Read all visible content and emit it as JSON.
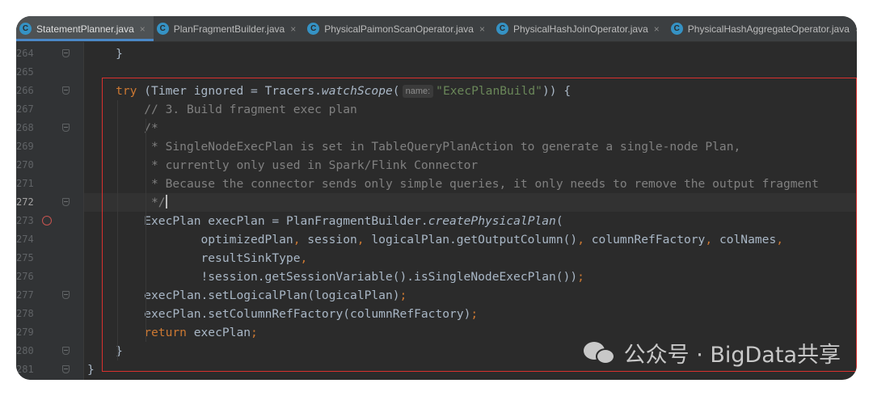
{
  "tabs": [
    {
      "label": "StatementPlanner.java",
      "active": true,
      "icon": "C"
    },
    {
      "label": "PlanFragmentBuilder.java",
      "active": false,
      "icon": "C"
    },
    {
      "label": "PhysicalPaimonScanOperator.java",
      "active": false,
      "icon": "C"
    },
    {
      "label": "PhysicalHashJoinOperator.java",
      "active": false,
      "icon": "C"
    },
    {
      "label": "PhysicalHashAggregateOperator.java",
      "active": false,
      "icon": "C"
    }
  ],
  "close_glyph": "×",
  "editor": {
    "current_line": "272",
    "breakpoint_line": "273",
    "lines": [
      {
        "n": "264",
        "indent": 4,
        "tokens": [
          {
            "t": "}",
            "c": ""
          }
        ]
      },
      {
        "n": "265",
        "indent": 0,
        "tokens": []
      },
      {
        "n": "266",
        "indent": 4,
        "tokens": [
          {
            "t": "try",
            "c": "kw"
          },
          {
            "t": " (Timer ignored = Tracers.",
            "c": ""
          },
          {
            "t": "watchScope",
            "c": "it"
          },
          {
            "t": "(",
            "c": ""
          },
          {
            "t": "name:",
            "c": "hint"
          },
          {
            "t": "\"ExecPlanBuild\"",
            "c": "str"
          },
          {
            "t": ")) {",
            "c": ""
          }
        ]
      },
      {
        "n": "267",
        "indent": 8,
        "tokens": [
          {
            "t": "// 3. Build fragment exec plan",
            "c": "cm"
          }
        ]
      },
      {
        "n": "268",
        "indent": 8,
        "tokens": [
          {
            "t": "/*",
            "c": "cm"
          }
        ]
      },
      {
        "n": "269",
        "indent": 9,
        "tokens": [
          {
            "t": "* SingleNodeExecPlan is set in TableQueryPlanAction to generate a single-node Plan,",
            "c": "cm"
          }
        ]
      },
      {
        "n": "270",
        "indent": 9,
        "tokens": [
          {
            "t": "* currently only used in Spark/Flink Connector",
            "c": "cm"
          }
        ]
      },
      {
        "n": "271",
        "indent": 9,
        "tokens": [
          {
            "t": "* Because the connector sends only simple queries, it only needs to remove the output fragment",
            "c": "cm"
          }
        ]
      },
      {
        "n": "272",
        "indent": 9,
        "tokens": [
          {
            "t": "*/",
            "c": "cm"
          },
          {
            "t": "",
            "c": "cursor"
          }
        ]
      },
      {
        "n": "273",
        "indent": 8,
        "tokens": [
          {
            "t": "ExecPlan execPlan = PlanFragmentBuilder.",
            "c": ""
          },
          {
            "t": "createPhysicalPlan",
            "c": "it"
          },
          {
            "t": "(",
            "c": ""
          }
        ]
      },
      {
        "n": "274",
        "indent": 16,
        "tokens": [
          {
            "t": "optimizedPlan",
            "c": ""
          },
          {
            "t": ", ",
            "c": "kw"
          },
          {
            "t": "session",
            "c": ""
          },
          {
            "t": ", ",
            "c": "kw"
          },
          {
            "t": "logicalPlan.getOutputColumn()",
            "c": ""
          },
          {
            "t": ", ",
            "c": "kw"
          },
          {
            "t": "columnRefFactory",
            "c": ""
          },
          {
            "t": ", ",
            "c": "kw"
          },
          {
            "t": "colNames",
            "c": ""
          },
          {
            "t": ",",
            "c": "kw"
          }
        ]
      },
      {
        "n": "275",
        "indent": 16,
        "tokens": [
          {
            "t": "resultSinkType",
            "c": ""
          },
          {
            "t": ",",
            "c": "kw"
          }
        ]
      },
      {
        "n": "276",
        "indent": 16,
        "tokens": [
          {
            "t": "!session.getSessionVariable().isSingleNodeExecPlan())",
            "c": ""
          },
          {
            "t": ";",
            "c": "kw"
          }
        ]
      },
      {
        "n": "277",
        "indent": 8,
        "tokens": [
          {
            "t": "execPlan.setLogicalPlan(logicalPlan)",
            "c": ""
          },
          {
            "t": ";",
            "c": "kw"
          }
        ]
      },
      {
        "n": "278",
        "indent": 8,
        "tokens": [
          {
            "t": "execPlan.setColumnRefFactory(columnRefFactory)",
            "c": ""
          },
          {
            "t": ";",
            "c": "kw"
          }
        ]
      },
      {
        "n": "279",
        "indent": 8,
        "tokens": [
          {
            "t": "return",
            "c": "kw"
          },
          {
            "t": " execPlan",
            "c": ""
          },
          {
            "t": ";",
            "c": "kw"
          }
        ]
      },
      {
        "n": "280",
        "indent": 4,
        "tokens": [
          {
            "t": "}",
            "c": ""
          }
        ]
      },
      {
        "n": "281",
        "indent": 0,
        "tokens": [
          {
            "t": "}",
            "c": ""
          }
        ]
      }
    ]
  },
  "watermark": {
    "text": "公众号 · BigData共享"
  },
  "colors": {
    "highlight_box": "#d9302e",
    "keyword": "#cc7832",
    "string": "#6a8759",
    "comment": "#808080"
  }
}
